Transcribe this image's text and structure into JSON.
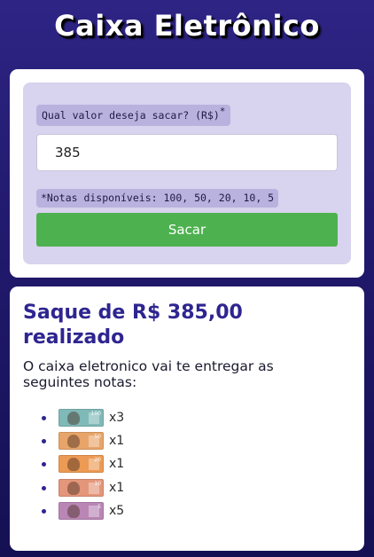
{
  "app": {
    "title": "Caixa Eletrônico"
  },
  "form": {
    "amount_label": "Qual valor deseja sacar? (R$)",
    "required_mark": "*",
    "amount_value": "385",
    "notes_hint": "*Notas disponíveis: 100, 50, 20, 10, 5",
    "submit_label": "Sacar"
  },
  "result": {
    "title": "Saque de R$ 385,00 realizado",
    "message": "O caixa eletronico vai te entregar as seguintes notas:",
    "notes": [
      {
        "denomination": "100",
        "count": "x3",
        "icon": "banknote-100-icon",
        "color": "#7fb9b8"
      },
      {
        "denomination": "50",
        "count": "x1",
        "icon": "banknote-50-icon",
        "color": "#e8a56a"
      },
      {
        "denomination": "20",
        "count": "x1",
        "icon": "banknote-20-icon",
        "color": "#ec9a54"
      },
      {
        "denomination": "10",
        "count": "x1",
        "icon": "banknote-10-icon",
        "color": "#e4967a"
      },
      {
        "denomination": "5",
        "count": "x5",
        "icon": "banknote-5-icon",
        "color": "#b986b5"
      }
    ]
  },
  "colors": {
    "background_top": "#2e2484",
    "background_bottom": "#151053",
    "panel": "#d8d3ee",
    "label_chip": "#b9b2de",
    "button": "#4db14f",
    "result_title": "#2e2590"
  }
}
